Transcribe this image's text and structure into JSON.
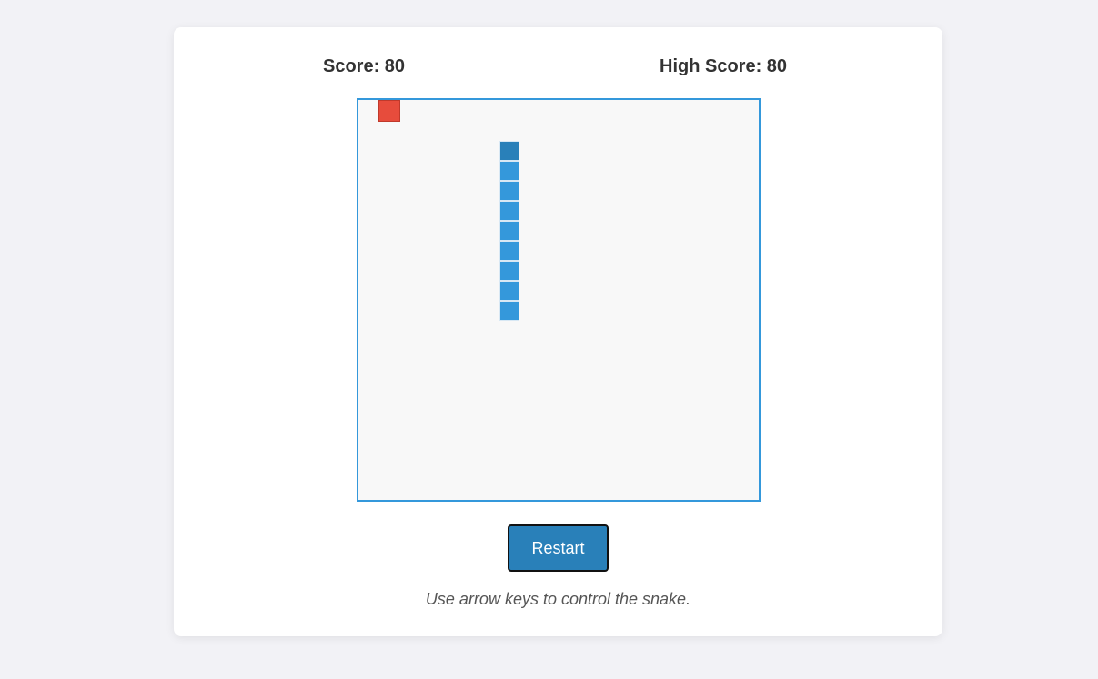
{
  "scoreboard": {
    "score_label": "Score: 80",
    "high_score_label": "High Score: 80"
  },
  "board": {
    "cell_size": 22,
    "columns": 20,
    "rows": 20,
    "food": {
      "col": 1,
      "row": 0
    },
    "snake": [
      {
        "col": 7,
        "row": 2
      },
      {
        "col": 7,
        "row": 3
      },
      {
        "col": 7,
        "row": 4
      },
      {
        "col": 7,
        "row": 5
      },
      {
        "col": 7,
        "row": 6
      },
      {
        "col": 7,
        "row": 7
      },
      {
        "col": 7,
        "row": 8
      },
      {
        "col": 7,
        "row": 9
      },
      {
        "col": 7,
        "row": 10
      }
    ]
  },
  "controls": {
    "restart_label": "Restart"
  },
  "instructions": "Use arrow keys to control the snake.",
  "colors": {
    "snake_head": "#2980b9",
    "snake_body": "#3498db",
    "food": "#e74c3c",
    "board_border": "#3498db"
  }
}
